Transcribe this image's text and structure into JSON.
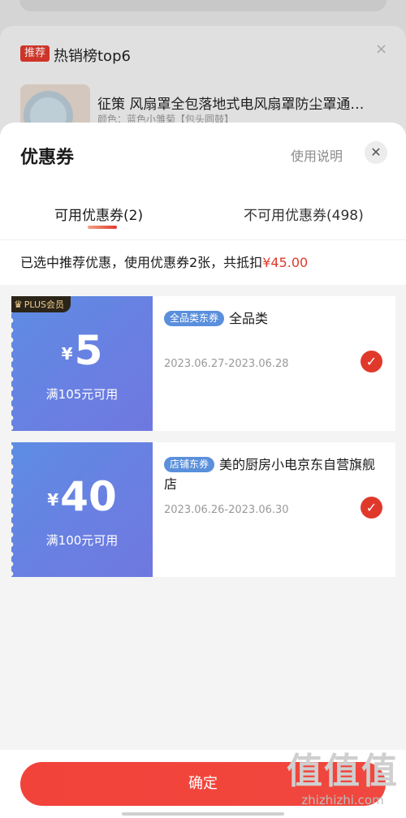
{
  "background": {
    "badge": "推荐",
    "title": "热销榜top6",
    "close_icon": "×",
    "product_title": "征策  风扇罩全包落地式电风扇罩防尘罩通…",
    "product_sub": "颜色：蓝色小雏菊【包头圆鼓】"
  },
  "sheet": {
    "title": "优惠券",
    "help_label": "使用说明",
    "close_icon": "✕"
  },
  "tabs": {
    "available": "可用优惠券(2)",
    "unavailable": "不可用优惠券(498)"
  },
  "summary": {
    "text": "已选中推荐优惠，使用优惠券2张，共抵扣",
    "amount": "¥45.00"
  },
  "coupons": [
    {
      "badge": "PLUS会员",
      "currency": "¥",
      "amount": "5",
      "condition": "满105元可用",
      "chip": "全品类东券",
      "scope": "全品类",
      "date": "2023.06.27-2023.06.28",
      "selected": true
    },
    {
      "currency": "¥",
      "amount": "40",
      "condition": "满100元可用",
      "chip": "店铺东券",
      "scope": "美的厨房小电京东自营旗舰店",
      "date": "2023.06.26-2023.06.30",
      "selected": true
    }
  ],
  "confirm_label": "确定",
  "watermark": {
    "big": "值值值",
    "small": "zhizhizhi.com"
  },
  "colors": {
    "accent": "#e0392c",
    "coupon_blue": "#6a7fe2",
    "chip_blue": "#5a8fdc"
  }
}
